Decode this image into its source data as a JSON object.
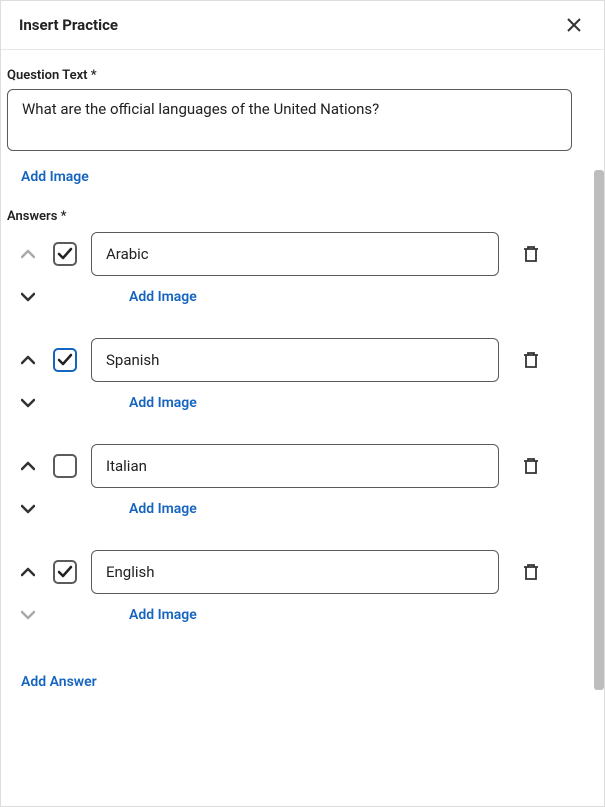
{
  "modal": {
    "title": "Insert Practice"
  },
  "question": {
    "label": "Question Text *",
    "text": "What are the official languages of the United Nations?",
    "add_image": "Add Image"
  },
  "answers": {
    "label": "Answers *",
    "add_image": "Add Image",
    "add_answer": "Add Answer",
    "items": [
      {
        "text": "Arabic",
        "checked": true,
        "selected": false
      },
      {
        "text": "Spanish",
        "checked": true,
        "selected": true
      },
      {
        "text": "Italian",
        "checked": false,
        "selected": false
      },
      {
        "text": "English",
        "checked": true,
        "selected": false
      }
    ]
  }
}
